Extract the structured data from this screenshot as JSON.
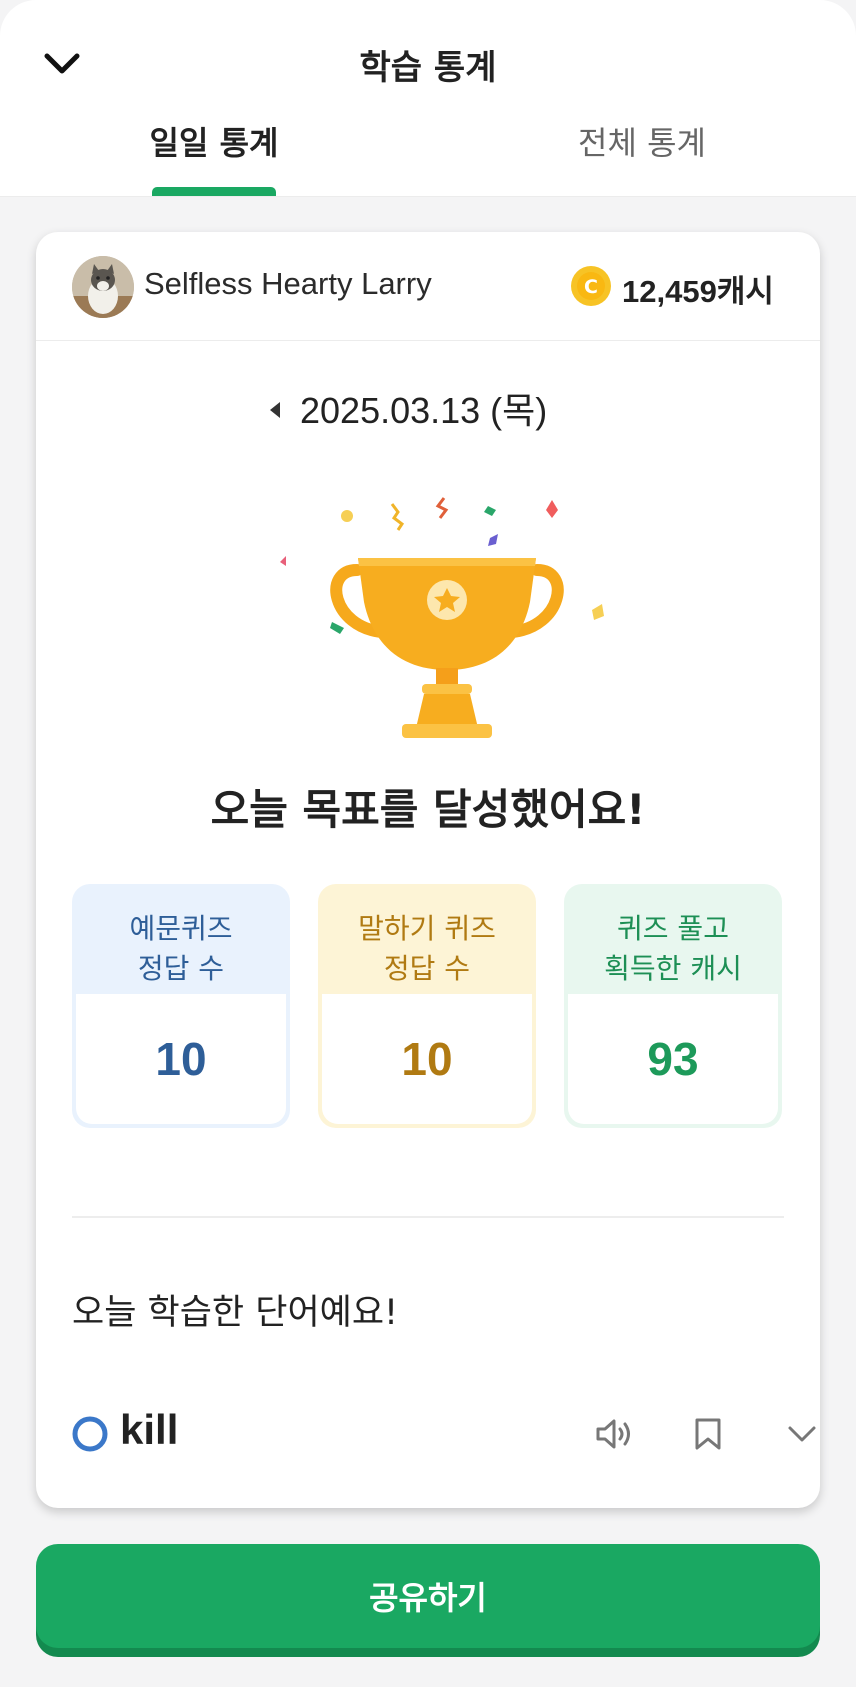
{
  "header": {
    "title": "학습 통계",
    "tabs": [
      {
        "label": "일일 통계",
        "active": true
      },
      {
        "label": "전체 통계",
        "active": false
      }
    ],
    "accent_color": "#1aa862"
  },
  "user": {
    "name": "Selfless Hearty Larry",
    "cash": "12,459캐시"
  },
  "date": "2025.03.13 (목)",
  "goal_message": "오늘 목표를 달성했어요!",
  "stats": [
    {
      "label_line1": "예문퀴즈",
      "label_line2": "정답 수",
      "value": "10"
    },
    {
      "label_line1": "말하기 퀴즈",
      "label_line2": "정답 수",
      "value": "10"
    },
    {
      "label_line1": "퀴즈 풀고",
      "label_line2": "획득한 캐시",
      "value": "93"
    }
  ],
  "learned": {
    "title": "오늘 학습한 단어예요!",
    "words": [
      {
        "word": "kill",
        "status_icon": "circle-correct-icon"
      }
    ]
  },
  "share_button": "공유하기"
}
